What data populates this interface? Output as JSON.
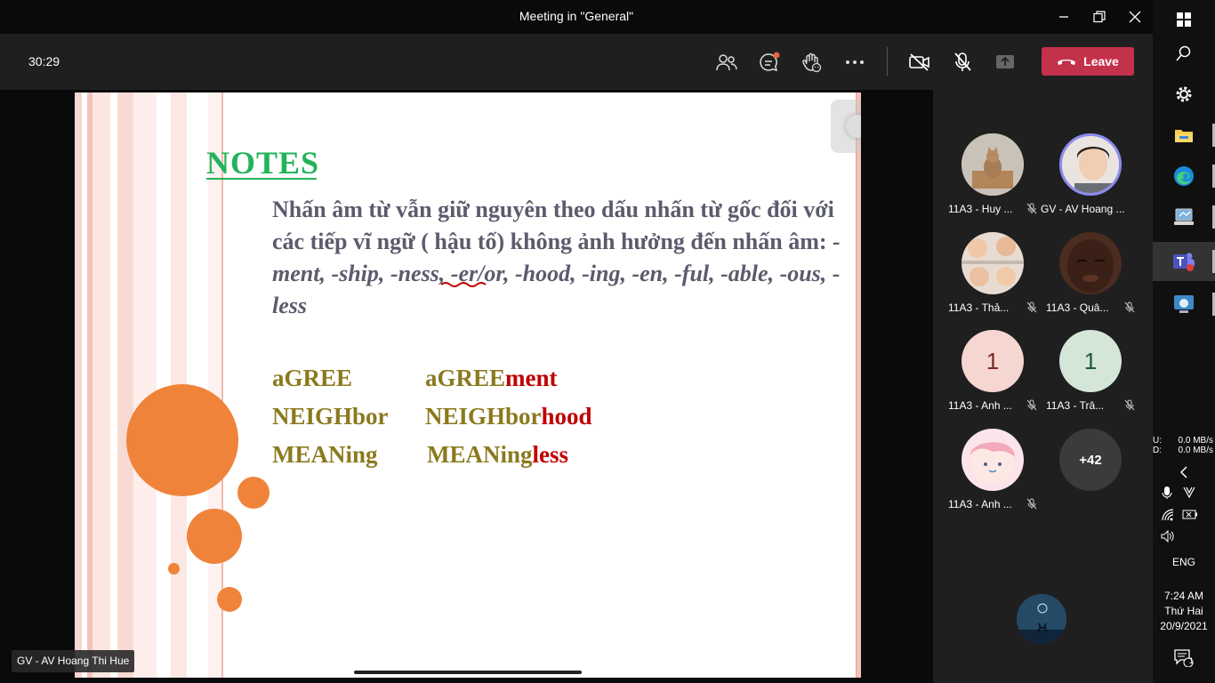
{
  "window": {
    "title": "Meeting in \"General\""
  },
  "toolbar": {
    "timer": "30:29",
    "leave_label": "Leave",
    "leave_color": "#c4314b"
  },
  "slide": {
    "title": "NOTES",
    "para_part1": "Nhấn âm từ vẫn giữ nguyên theo dấu nhấn từ gốc đối với các tiếp vĩ ngữ ( hậu tố) không ảnh hưởng đến nhấn âm: ",
    "para_suffixes": "-ment, -ship, -ness, -er/or, -hood, -ing, -en, -ful, -able, -ous, -less",
    "rows": [
      {
        "base": "aGREE",
        "derived_stem": "aGREE",
        "derived_suffix": "ment"
      },
      {
        "base": "NEIGHbor",
        "derived_stem": "NEIGHbor",
        "derived_suffix": "hood"
      },
      {
        "base": "MEANing",
        "derived_stem": "MEANing",
        "derived_suffix": "less"
      }
    ],
    "title_color": "#22b45a",
    "word_color": "#8a7a1e",
    "suffix_color": "#c00000"
  },
  "presenter": {
    "label": "GV - AV Hoang Thi Hue"
  },
  "participants": [
    {
      "name": "11A3 - Huy ...",
      "avatar": "photo-cat"
    },
    {
      "name": "GV - AV Hoang ...",
      "avatar": "photo-woman"
    },
    {
      "name": "11A3 - Thả...",
      "avatar": "photo-collage"
    },
    {
      "name": "11A3 - Quâ...",
      "avatar": "photo-man"
    },
    {
      "name": "11A3 - Anh ...",
      "avatar_initial": "1",
      "avatar_bg": "#f6d6d0"
    },
    {
      "name": "11A3 - Trâ...",
      "avatar_initial": "1",
      "avatar_bg": "#d3e6d8"
    },
    {
      "name": "11A3 - Anh ...",
      "avatar": "cartoon-face"
    }
  ],
  "overflow": {
    "label": "+42"
  },
  "taskbar": {
    "net_upload_label": "U:",
    "net_upload": "0.0 MB/s",
    "net_download_label": "D:",
    "net_download": "0.0 MB/s",
    "language": "ENG",
    "time": "7:24 AM",
    "day": "Thứ Hai",
    "date": "20/9/2021",
    "notification_count": "1"
  }
}
